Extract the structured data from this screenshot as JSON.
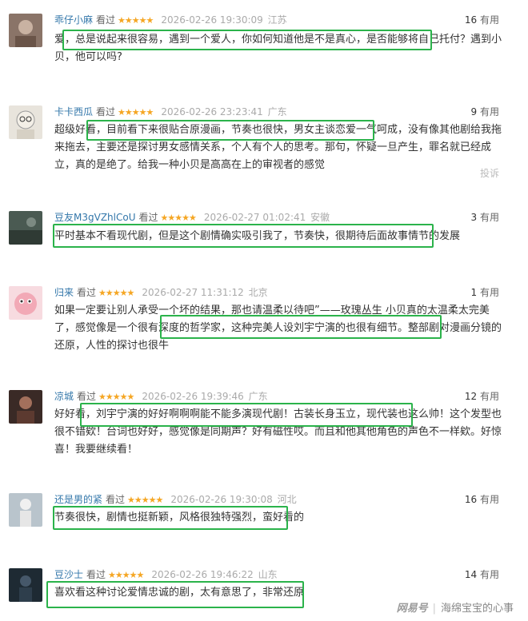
{
  "reviews": [
    {
      "user": "乖仔小麻",
      "action": "看过",
      "stars": "★★★★★",
      "time": "2026-02-26 19:30:09",
      "location": "江苏",
      "useful_count": "16",
      "useful_label": "有用",
      "content": "爱，总是说起来很容易，遇到一个爱人，你如何知道他是不是真心，是否能够将自己托付？遇到小贝，他可以吗?"
    },
    {
      "user": "卡卡西瓜",
      "action": "看过",
      "stars": "★★★★★",
      "time": "2026-02-26 23:23:41",
      "location": "广东",
      "useful_count": "9",
      "useful_label": "有用",
      "content": "超级好看，目前看下来很贴合原漫画，节奏也很快，男女主谈恋爱一气呵成，没有像其他剧给我拖来拖去，主要还是探讨男女感情关系，个人有个人的思考。那句，怀疑一旦产生，罪名就已经成立，真的是绝了。给我一种小贝是高高在上的审视者的感觉",
      "report": "投诉"
    },
    {
      "user": "豆友M3gVZhlCoU",
      "action": "看过",
      "stars": "★★★★★",
      "time": "2026-02-27 01:02:41",
      "location": "安徽",
      "useful_count": "3",
      "useful_label": "有用",
      "content": "平时基本不看现代剧，但是这个剧情确实吸引我了，节奏快，很期待后面故事情节的发展"
    },
    {
      "user": "归来",
      "action": "看过",
      "stars": "★★★★★",
      "time": "2026-02-27 11:31:12",
      "location": "北京",
      "useful_count": "1",
      "useful_label": "有用",
      "content": "如果一定要让别人承受一个坏的结果，那也请温柔以待吧”——玫瑰丛生 小贝真的太温柔太完美了，感觉像是一个很有深度的哲学家，这种完美人设刘宇宁演的也很有细节。整部剧对漫画分镜的还原，人性的探讨也很牛"
    },
    {
      "user": "凉城",
      "action": "看过",
      "stars": "★★★★★",
      "time": "2026-02-26 19:39:46",
      "location": "广东",
      "useful_count": "12",
      "useful_label": "有用",
      "content": "好好看，刘宇宁演的好好啊啊啊能不能多演现代剧！古装长身玉立，现代装也这么帅！这个发型也很不错欸！台词也好好，感觉像是同期声？好有磁性哎。而且和他其他角色的声色不一样欸。好惊喜！我要继续看！"
    },
    {
      "user": "还是男的紧",
      "action": "看过",
      "stars": "★★★★★",
      "time": "2026-02-26 19:30:08",
      "location": "河北",
      "useful_count": "16",
      "useful_label": "有用",
      "content": "节奏很快，剧情也挺新颖，风格很独特强烈，蛮好看的"
    },
    {
      "user": "豆沙士",
      "action": "看过",
      "stars": "★★★★★",
      "time": "2026-02-26 19:46:22",
      "location": "山东",
      "useful_count": "14",
      "useful_label": "有用",
      "content": "喜欢看这种讨论爱情忠诚的剧，太有意思了，非常还原"
    }
  ],
  "footer": {
    "brand": "网易号",
    "separator": "|",
    "account": "海绵宝宝的心事"
  },
  "colors": {
    "highlight": "#2bb34b",
    "username": "#3377aa",
    "stars": "#f5a623"
  }
}
